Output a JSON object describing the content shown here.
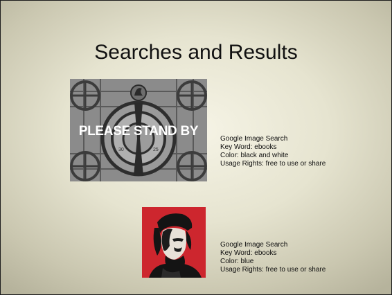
{
  "slide": {
    "title": "Searches and Results"
  },
  "results": [
    {
      "image_text": "PLEASE STAND BY",
      "image_style": "black and white test pattern",
      "lines": [
        "Google Image Search",
        "Key Word: ebooks",
        "Color: black and white",
        "Usage Rights: free to use or share"
      ]
    },
    {
      "image_style": "portrait on red background",
      "lines": [
        "Google Image Search",
        "Key Word: ebooks",
        "Color: blue",
        "Usage Rights: free to use or share"
      ]
    }
  ],
  "colors": {
    "slide_background": "#e6e4d0",
    "title_text": "#111111",
    "caption_text": "#0d0d0d",
    "portrait_red": "#d42a30"
  }
}
